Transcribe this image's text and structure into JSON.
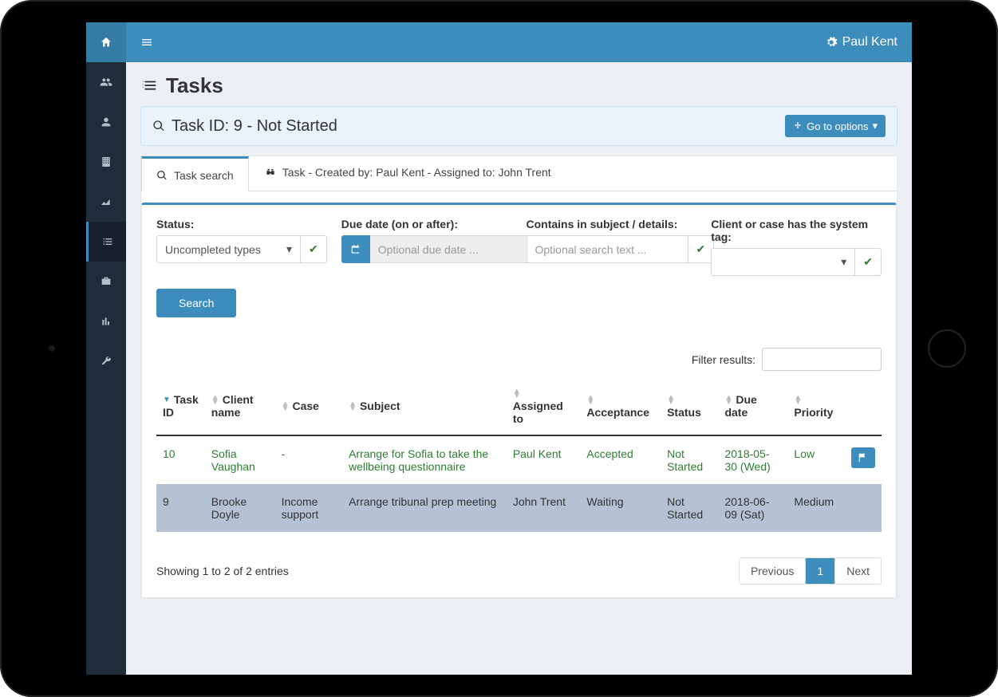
{
  "user": {
    "name": "Paul Kent"
  },
  "page": {
    "title": "Tasks"
  },
  "panel": {
    "title": "Task ID: 9 - Not Started",
    "go_button": "Go to options"
  },
  "tabs": [
    {
      "label": "Task search"
    },
    {
      "label": "Task - Created by: Paul Kent - Assigned to: John Trent"
    }
  ],
  "filters": {
    "status": {
      "label": "Status:",
      "value": "Uncompleted types"
    },
    "due": {
      "label": "Due date (on or after):",
      "placeholder": "Optional due date ..."
    },
    "contains": {
      "label": "Contains in subject / details:",
      "placeholder": "Optional search text ..."
    },
    "tag": {
      "label": "Client or case has the system tag:",
      "value": ""
    },
    "search_btn": "Search"
  },
  "filter_results_label": "Filter results:",
  "columns": [
    "Task ID",
    "Client name",
    "Case",
    "Subject",
    "Assigned to",
    "Acceptance",
    "Status",
    "Due date",
    "Priority"
  ],
  "rows": [
    {
      "task_id": "10",
      "client": "Sofia Vaughan",
      "case": "-",
      "subject": "Arrange for Sofia to take the wellbeing questionnaire",
      "assigned": "Paul Kent",
      "acceptance": "Accepted",
      "status": "Not Started",
      "due": "2018-05-30 (Wed)",
      "priority": "Low"
    },
    {
      "task_id": "9",
      "client": "Brooke Doyle",
      "case": "Income support",
      "subject": "Arrange tribunal prep meeting",
      "assigned": "John Trent",
      "acceptance": "Waiting",
      "status": "Not Started",
      "due": "2018-06-09 (Sat)",
      "priority": "Medium"
    }
  ],
  "showing": "Showing 1 to 2 of 2 entries",
  "pager": {
    "prev": "Previous",
    "page": "1",
    "next": "Next"
  }
}
